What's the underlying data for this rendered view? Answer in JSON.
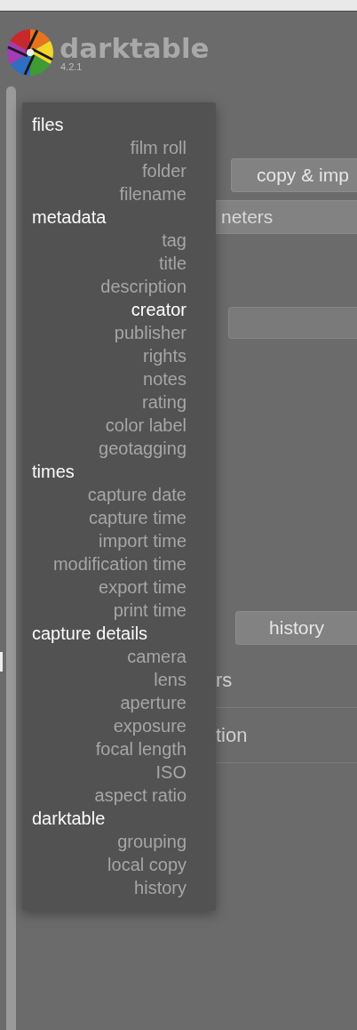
{
  "app": {
    "name": "darktable",
    "version": "4.2.1"
  },
  "panel": {
    "import_button": "copy & imp",
    "parameters_field": "neters",
    "history_button": "history",
    "rows": [
      "rs",
      "tion"
    ]
  },
  "menu": {
    "groups": [
      {
        "label": "files",
        "items": [
          {
            "label": "film roll",
            "selected": false
          },
          {
            "label": "folder",
            "selected": false
          },
          {
            "label": "filename",
            "selected": false
          }
        ]
      },
      {
        "label": "metadata",
        "items": [
          {
            "label": "tag",
            "selected": false
          },
          {
            "label": "title",
            "selected": false
          },
          {
            "label": "description",
            "selected": false
          },
          {
            "label": "creator",
            "selected": true
          },
          {
            "label": "publisher",
            "selected": false
          },
          {
            "label": "rights",
            "selected": false
          },
          {
            "label": "notes",
            "selected": false
          },
          {
            "label": "rating",
            "selected": false
          },
          {
            "label": "color label",
            "selected": false
          },
          {
            "label": "geotagging",
            "selected": false
          }
        ]
      },
      {
        "label": "times",
        "items": [
          {
            "label": "capture date",
            "selected": false
          },
          {
            "label": "capture time",
            "selected": false
          },
          {
            "label": "import time",
            "selected": false
          },
          {
            "label": "modification time",
            "selected": false
          },
          {
            "label": "export time",
            "selected": false
          },
          {
            "label": "print time",
            "selected": false
          }
        ]
      },
      {
        "label": "capture details",
        "items": [
          {
            "label": "camera",
            "selected": false
          },
          {
            "label": "lens",
            "selected": false
          },
          {
            "label": "aperture",
            "selected": false
          },
          {
            "label": "exposure",
            "selected": false
          },
          {
            "label": "focal length",
            "selected": false
          },
          {
            "label": "ISO",
            "selected": false
          },
          {
            "label": "aspect ratio",
            "selected": false
          }
        ]
      },
      {
        "label": "darktable",
        "items": [
          {
            "label": "grouping",
            "selected": false
          },
          {
            "label": "local copy",
            "selected": false
          },
          {
            "label": "history",
            "selected": false
          }
        ]
      }
    ]
  }
}
